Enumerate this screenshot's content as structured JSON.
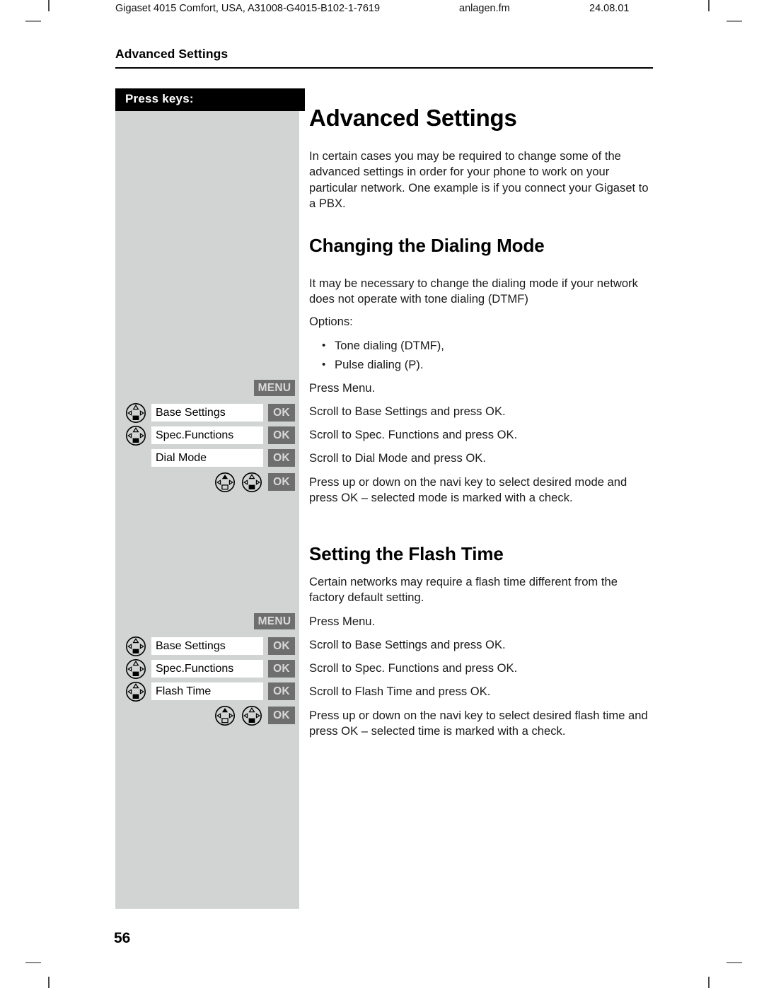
{
  "document": {
    "running_header": {
      "doc_id": "Gigaset 4015 Comfort, USA, A31008-G4015-B102-1-7619",
      "file_name": "anlagen.fm",
      "date": "24.08.01"
    },
    "chapter_title": "Advanced Settings",
    "page_number": "56"
  },
  "sidebar": {
    "heading": "Press keys:",
    "panel_color": "#d2d4d4",
    "heading_bar_color": "#000000",
    "chip_color": "#6e6e6e",
    "chip_text_color": "#d9d9d9",
    "blocks": [
      {
        "name": "dialing-mode-keys",
        "rows": [
          {
            "navi": "none",
            "label": null,
            "chip": "MENU"
          },
          {
            "navi": "scroll-down",
            "label": "Base Settings",
            "chip": "OK"
          },
          {
            "navi": "scroll-down",
            "label": "Spec.Functions",
            "chip": "OK"
          },
          {
            "navi": "none",
            "label": "Dial Mode",
            "chip": "OK"
          },
          {
            "navi": "pair",
            "label": null,
            "chip": "OK"
          }
        ]
      },
      {
        "name": "flash-time-keys",
        "rows": [
          {
            "navi": "none",
            "label": null,
            "chip": "MENU"
          },
          {
            "navi": "scroll-down",
            "label": "Base Settings",
            "chip": "OK"
          },
          {
            "navi": "scroll-down",
            "label": "Spec.Functions",
            "chip": "OK"
          },
          {
            "navi": "scroll-down",
            "label": "Flash Time",
            "chip": "OK"
          },
          {
            "navi": "pair",
            "label": null,
            "chip": "OK"
          }
        ]
      }
    ]
  },
  "main": {
    "title": "Advanced Settings",
    "intro": "In certain cases you may be required to change some of the advanced settings in order for your phone to work on your particular network.  One example is if you connect your Gigaset to a PBX.",
    "sections": [
      {
        "heading": "Changing the Dialing Mode",
        "intro": "It may be  necessary to change the dialing mode if your network does not operate with tone dialing (DTMF)",
        "options_label": "Options:",
        "options": [
          "Tone dialing (DTMF),",
          "Pulse dialing (P)."
        ],
        "steps": [
          "Press Menu.",
          "Scroll to Base Settings and press OK.",
          "Scroll to Spec. Functions and press OK.",
          "Scroll to Dial Mode and press OK.",
          "Press up or down on the navi key to select desired mode and press OK – selected mode is marked with a check."
        ]
      },
      {
        "heading": "Setting the Flash Time",
        "intro": "Certain networks may require a flash time different from the factory default setting.",
        "steps": [
          "Press Menu.",
          "Scroll to Base Settings and press OK.",
          "Scroll to Spec. Functions and press OK.",
          "Scroll to Flash Time and press OK.",
          "Press up or down on the navi key to select desired flash time and press OK – selected time is marked with a check."
        ]
      }
    ]
  }
}
